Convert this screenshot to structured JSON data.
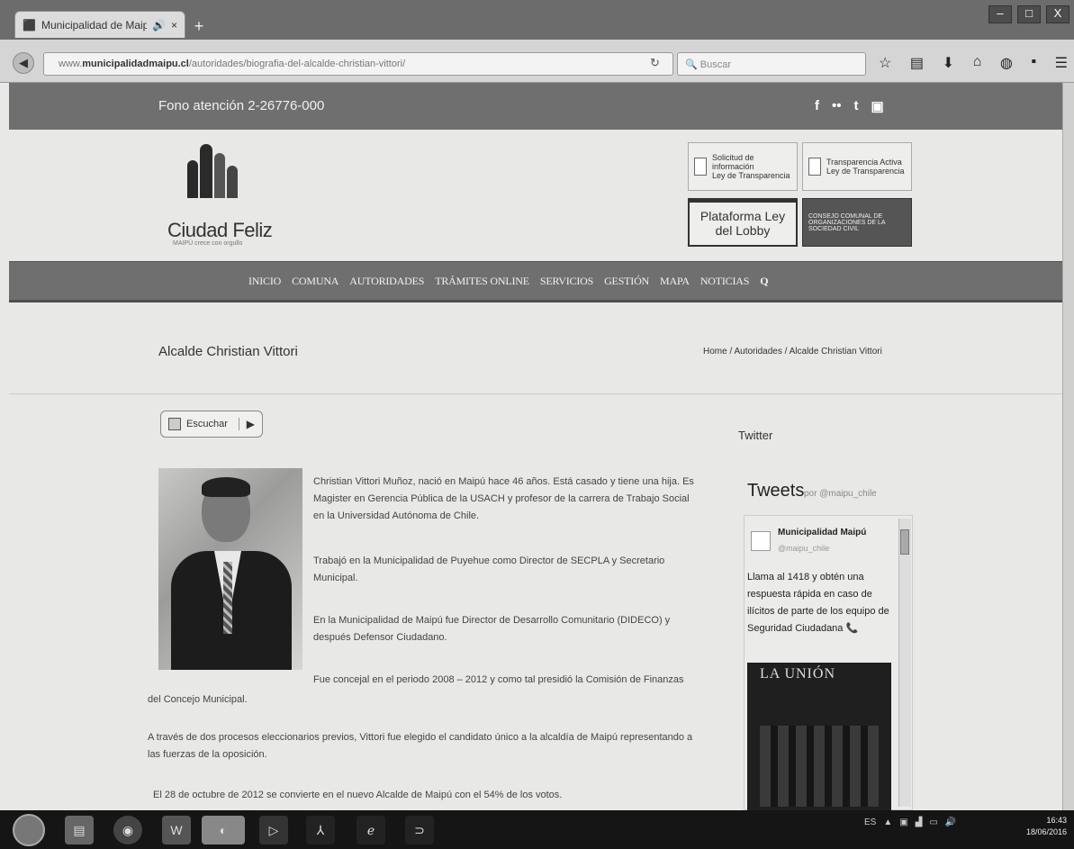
{
  "browser": {
    "tab_title": "Municipalidad de Maip...",
    "new_tab": "+",
    "url_prefix": "www.",
    "url_domain": "municipalidadmaipu.cl",
    "url_path": "/autoridades/biografia-del-alcalde-christian-vittori/",
    "search_placeholder": "Buscar",
    "window_controls": [
      "–",
      "□",
      "X"
    ]
  },
  "site": {
    "phone": "Fono atención 2-26776-000",
    "social": [
      "f",
      "••",
      "t",
      "▣"
    ],
    "logo_name": "Ciudad Feliz",
    "logo_tagline": "MAIPÚ crece con orgullo",
    "buttons": {
      "info_line1": "Solicitud de información",
      "info_line2": "Ley de Transparencia",
      "transp_line1": "Transparencia Activa",
      "transp_line2": "Ley de Transparencia",
      "lobby": "Plataforma Ley del Lobby",
      "consejo": "CONSEJO COMUNAL DE ORGANIZACIONES DE LA SOCIEDAD CIVIL"
    },
    "menu": [
      "INICIO",
      "COMUNA",
      "AUTORIDADES",
      "TRÁMITES ONLINE",
      "SERVICIOS",
      "GESTIÓN",
      "MAPA",
      "NOTICIAS"
    ],
    "menu_search": "Q",
    "page_title": "Alcalde Christian Vittori",
    "breadcrumb": "Home / Autoridades / Alcalde Christian Vittori",
    "listen_label": "Escuchar",
    "listen_play": "▶",
    "bio": {
      "p1": "Christian Vittori Muñoz, nació en Maipú hace 46 años. Está casado y tiene una hija. Es Magister en Gerencia Pública de la USACH y profesor de la carrera de Trabajo Social en la Universidad Autónoma de Chile.",
      "p2": "Trabajó en la Municipalidad de Puyehue como Director de SECPLA y Secretario Municipal.",
      "p3": "En la Municipalidad de Maipú fue Director de Desarrollo Comunitario (DIDECO) y después Defensor Ciudadano.",
      "p4a": "Fue concejal en el periodo 2008 – 2012 y como tal presidió la Comisión de Finanzas",
      "p4b": "del Concejo Municipal.",
      "p5": "A través de dos procesos eleccionarios previos, Vittori fue elegido el candidato único a la alcaldía de Maipú representando a las fuerzas de la oposición.",
      "p6": "El 28 de octubre de 2012 se convierte en el nuevo Alcalde de Maipú con el 54% de los votos."
    },
    "twitter": {
      "heading": "Twitter",
      "tweets_title": "Tweets",
      "tweets_by": "por @maipu_chile",
      "account_name": "Municipalidad Maipú",
      "account_handle": "@maipu_chile",
      "tweet_text": "Llama al 1418 y obtén una respuesta rápida en caso de ilícitos de parte de los equipo de Seguridad Ciudadana 📞",
      "media_title": "LA UNIÓN"
    }
  },
  "taskbar": {
    "language": "ES",
    "time": "16:43",
    "date": "18/06/2016"
  }
}
